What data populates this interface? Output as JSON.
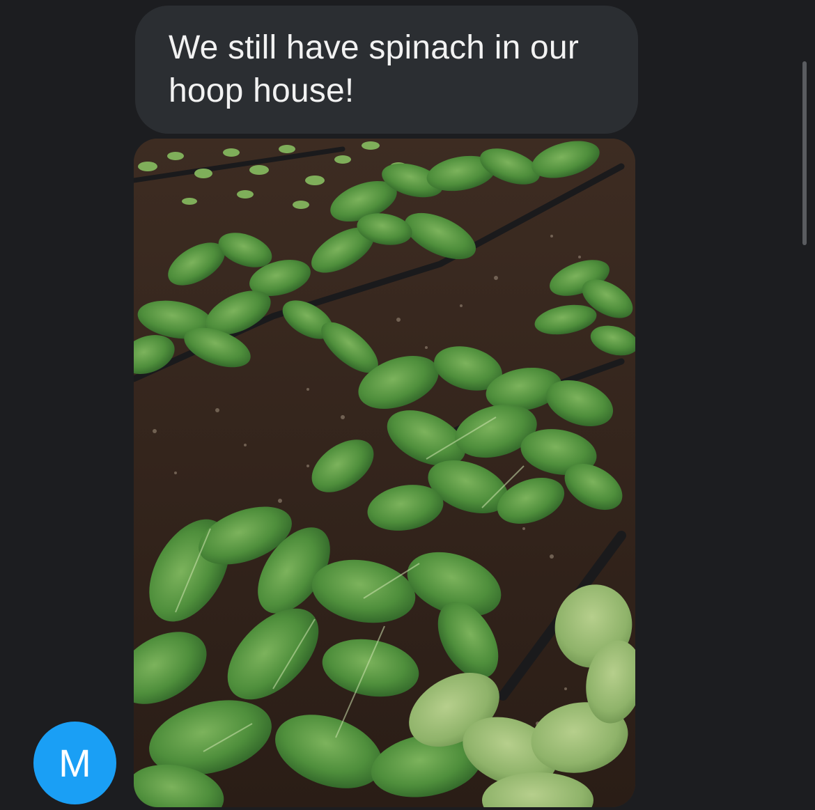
{
  "conversation": {
    "messages": [
      {
        "type": "text",
        "text": "We still have spinach in our hoop house!"
      },
      {
        "type": "image",
        "subject": "photo"
      }
    ],
    "sender": {
      "avatar_initial": "M",
      "avatar_color": "#1a9ff5"
    }
  },
  "colors": {
    "background": "#1c1d20",
    "bubble": "#2b2e32",
    "text": "#f2f2f2",
    "scrollbar": "#5a5c60"
  }
}
